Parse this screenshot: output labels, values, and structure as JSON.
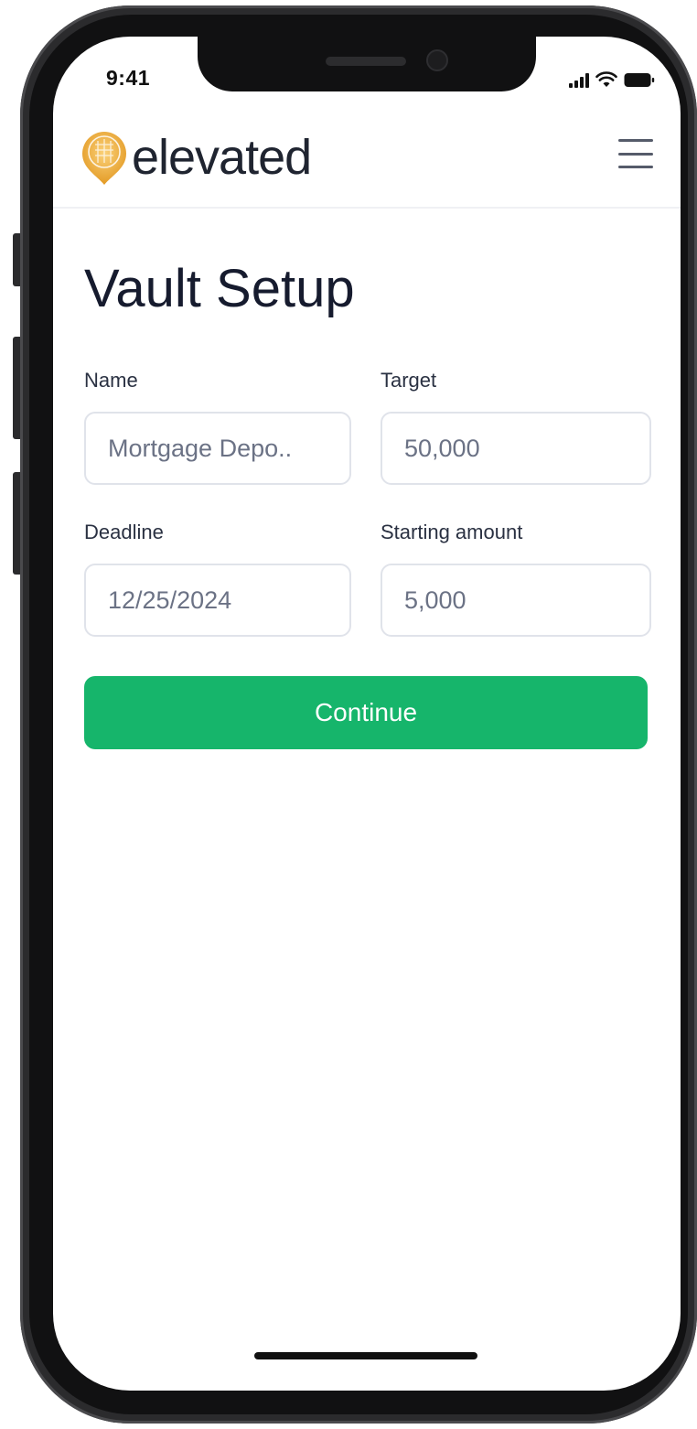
{
  "status_bar": {
    "time": "9:41"
  },
  "header": {
    "brand": "elevated",
    "logo_icon": "elevated-logo-icon",
    "menu_icon": "hamburger-menu-icon"
  },
  "page": {
    "title": "Vault Setup"
  },
  "form": {
    "name": {
      "label": "Name",
      "placeholder": "Mortgage Depo.."
    },
    "target": {
      "label": "Target",
      "placeholder": "50,000"
    },
    "deadline": {
      "label": "Deadline",
      "placeholder": "12/25/2024"
    },
    "starting_amount": {
      "label": "Starting amount",
      "placeholder": "5,000"
    }
  },
  "actions": {
    "continue_label": "Continue"
  },
  "colors": {
    "accent": "#16b56b",
    "brand_gold": "#e8a93a",
    "title": "#161b2e"
  }
}
